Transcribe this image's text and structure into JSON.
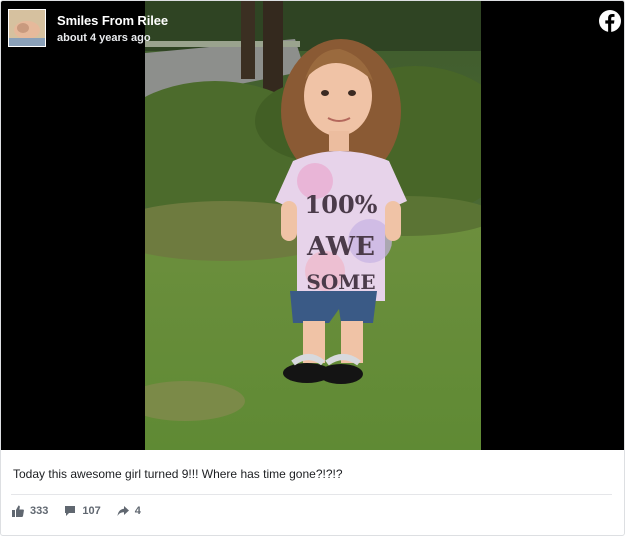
{
  "post": {
    "page_name": "Smiles From Rilee",
    "timestamp": "about 4 years ago",
    "caption": "Today this awesome girl turned 9!!! Where has time gone?!?!?",
    "photo": {
      "description_icon": "photo",
      "shirt_text": [
        "100%",
        "AWE",
        "SOME"
      ]
    },
    "logo_icon": "facebook-icon"
  },
  "stats": {
    "likes": "333",
    "comments": "107",
    "shares": "4"
  },
  "icons": {
    "like": "thumbs-up-icon",
    "comment": "comment-icon",
    "share": "share-arrow-icon"
  },
  "colors": {
    "media_background": "#000000",
    "facebook_blue": "#ffffff",
    "meta_text": "#606770"
  }
}
